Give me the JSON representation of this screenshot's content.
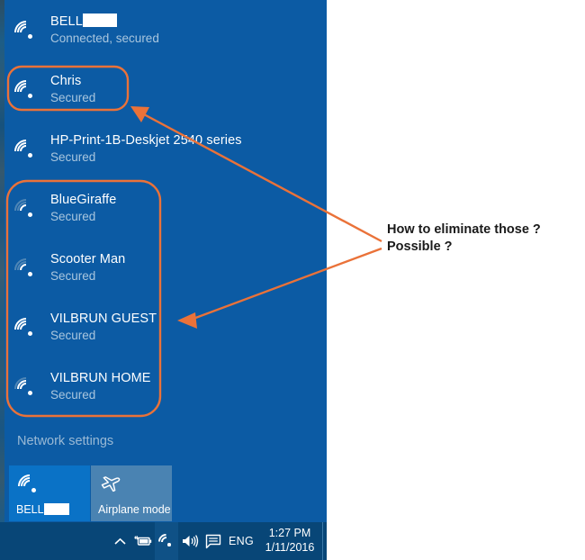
{
  "flyout": {
    "networks": [
      {
        "name": "BELL",
        "redacted": true,
        "status": "Connected, secured",
        "signal": 4,
        "highlight": "none"
      },
      {
        "name": "Chris",
        "redacted": false,
        "status": "Secured",
        "signal": 4,
        "highlight": "single"
      },
      {
        "name": "HP-Print-1B-Deskjet 2540 series",
        "redacted": false,
        "status": "Secured",
        "signal": 4,
        "highlight": "none"
      },
      {
        "name": "BlueGiraffe",
        "redacted": false,
        "status": "Secured",
        "signal": 2,
        "highlight": "group"
      },
      {
        "name": "Scooter Man",
        "redacted": false,
        "status": "Secured",
        "signal": 2,
        "highlight": "group"
      },
      {
        "name": "VILBRUN GUEST",
        "redacted": false,
        "status": "Secured",
        "signal": 4,
        "highlight": "group"
      },
      {
        "name": "VILBRUN HOME",
        "redacted": false,
        "status": "Secured",
        "signal": 3,
        "highlight": "group"
      }
    ],
    "network_settings_label": "Network settings",
    "tiles": [
      {
        "label": "BELL",
        "redacted": true,
        "icon": "wifi-icon",
        "state": "on"
      },
      {
        "label": "Airplane mode",
        "redacted": false,
        "icon": "airplane-icon",
        "state": "off"
      }
    ]
  },
  "taskbar": {
    "chevron_icon": "show-hidden-icons-chevron",
    "battery_icon": "battery-charging-icon",
    "wifi_icon": "wifi-icon",
    "volume_icon": "volume-icon",
    "action_center_icon": "action-center-icon",
    "language": "ENG",
    "time": "1:27 PM",
    "date": "1/11/2016"
  },
  "annotation": {
    "line1": "How to eliminate those ?",
    "line2": "Possible ?",
    "color": "#ea7239"
  },
  "colors": {
    "flyout_bg": "#0c5ba4",
    "taskbar_bg": "#084677",
    "tile_on": "#0a72c6",
    "tile_off": "#4a83b2",
    "accent_orange": "#ea7239",
    "name_text": "#ffffff",
    "status_text": "#a9c6de"
  }
}
